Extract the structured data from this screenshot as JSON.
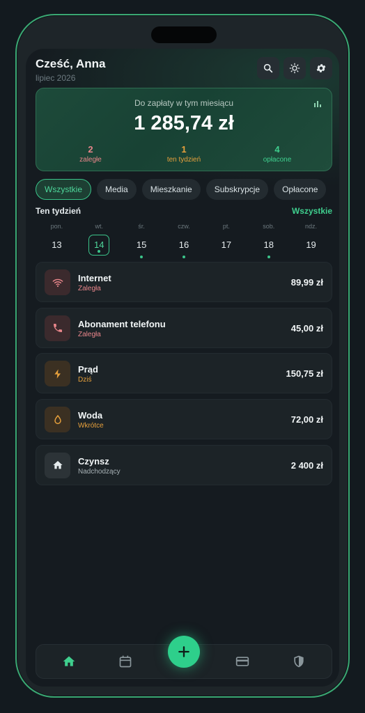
{
  "header": {
    "greeting": "Cześć, Anna",
    "month": "lipiec 2026"
  },
  "summary": {
    "label": "Do zapłaty w tym miesiącu",
    "amount": "1 285,74 zł",
    "stats": [
      {
        "value": "2",
        "label": "zaległe",
        "color": "#e9868b"
      },
      {
        "value": "1",
        "label": "ten tydzień",
        "color": "#e8a13c"
      },
      {
        "value": "4",
        "label": "opłacone",
        "color": "#3fcf8e"
      }
    ]
  },
  "filters": [
    "Wszystkie",
    "Media",
    "Mieszkanie",
    "Subskrypcje",
    "Opłacone"
  ],
  "week": {
    "title": "Ten tydzień",
    "all_link": "Wszystkie",
    "days": [
      {
        "name": "pon.",
        "num": "13",
        "active": false,
        "dot": false
      },
      {
        "name": "wt.",
        "num": "14",
        "active": true,
        "dot": true
      },
      {
        "name": "śr.",
        "num": "15",
        "active": false,
        "dot": true
      },
      {
        "name": "czw.",
        "num": "16",
        "active": false,
        "dot": true
      },
      {
        "name": "pt.",
        "num": "17",
        "active": false,
        "dot": false
      },
      {
        "name": "sob.",
        "num": "18",
        "active": false,
        "dot": true
      },
      {
        "name": "ndz.",
        "num": "19",
        "active": false,
        "dot": false
      }
    ]
  },
  "bills": [
    {
      "name": "Internet",
      "status": "Zaległa",
      "amount": "89,99 zł",
      "icon": "wifi-icon",
      "status_color": "#e9868b",
      "icon_bg": "#3b2a2d",
      "icon_color": "#e9868b"
    },
    {
      "name": "Abonament telefonu",
      "status": "Zaległa",
      "amount": "45,00 zł",
      "icon": "phone-icon",
      "status_color": "#e9868b",
      "icon_bg": "#3b2a2d",
      "icon_color": "#e9868b"
    },
    {
      "name": "Prąd",
      "status": "Dziś",
      "amount": "150,75 zł",
      "icon": "bolt-icon",
      "status_color": "#e8a13c",
      "icon_bg": "#3b3022",
      "icon_color": "#e8a13c"
    },
    {
      "name": "Woda",
      "status": "Wkrótce",
      "amount": "72,00 zł",
      "icon": "drop-icon",
      "status_color": "#e8a13c",
      "icon_bg": "#3b3022",
      "icon_color": "#e8a13c"
    },
    {
      "name": "Czynsz",
      "status": "Nadchodzący",
      "amount": "2 400 zł",
      "icon": "home-icon",
      "status_color": "#a7b1b5",
      "icon_bg": "#2c3337",
      "icon_color": "#e6ecee"
    }
  ],
  "nav": {
    "items": [
      "home-icon",
      "calendar-icon",
      "add-icon",
      "card-icon",
      "shield-icon"
    ],
    "active": "home-icon",
    "accent": "#3fcf8e"
  }
}
